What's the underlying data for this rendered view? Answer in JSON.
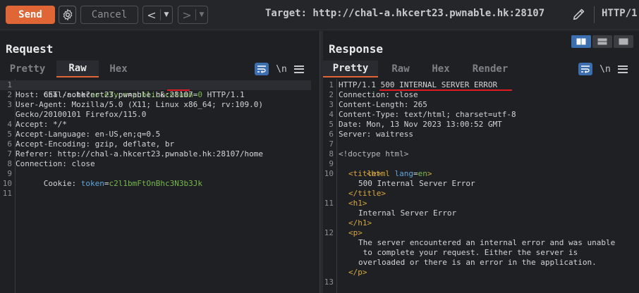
{
  "toolbar": {
    "send_label": "Send",
    "cancel_label": "Cancel",
    "target_label": "Target: http://chal-a.hkcert23.pwnable.hk:28107",
    "http_version": "HTTP/1",
    "accent": "#e16636"
  },
  "request": {
    "title": "Request",
    "tabs": [
      "Pretty",
      "Raw",
      "Hex"
    ],
    "active_tab": "Raw",
    "newline_icon": "\\n",
    "lines": {
      "l1_method": "GET /note?",
      "l1_p1k": "noteType",
      "l1_eq1": "=",
      "l1_p1v": "public",
      "l1_amp": "&",
      "l1_p2k": "column",
      "l1_eq2": "=",
      "l1_p2v": "0",
      "l1_ver": " HTTP/1.1",
      "l2": "Host: chal-a.hkcert23.pwnable.hk:28107",
      "l3a": "User-Agent: Mozilla/5.0 (X11; Linux x86_64; rv:109.0)",
      "l3b": "Gecko/20100101 Firefox/115.0",
      "l4": "Accept: */*",
      "l5": "Accept-Language: en-US,en;q=0.5",
      "l6": "Accept-Encoding: gzip, deflate, br",
      "l7": "Referer: http://chal-a.hkcert23.pwnable.hk:28107/home",
      "l8": "Connection: close",
      "l9k": "Cookie: ",
      "l9n": "token",
      "l9e": "=",
      "l9v": "c2l1bmFtOnBhc3N3b3Jk"
    },
    "line_numbers": [
      "1",
      "2",
      "3",
      "",
      "4",
      "5",
      "6",
      "7",
      "8",
      "9",
      "10",
      "11"
    ]
  },
  "response": {
    "title": "Response",
    "tabs": [
      "Pretty",
      "Raw",
      "Hex",
      "Render"
    ],
    "active_tab": "Pretty",
    "newline_icon": "\\n",
    "lines": {
      "l1": "HTTP/1.1 500 INTERNAL SERVER ERROR",
      "l2": "Connection: close",
      "l3": "Content-Length: 265",
      "l4": "Content-Type: text/html; charset=utf-8",
      "l5": "Date: Mon, 13 Nov 2023 13:00:52 GMT",
      "l6": "Server: waitress",
      "l8": "<!doctype html>",
      "l9a": "<html ",
      "l9b": "lang",
      "l9c": "=",
      "l9d": "en",
      "l9e": ">",
      "l10a": "<title>",
      "l10b": "500 Internal Server Error",
      "l10c": "</title>",
      "l11a": "<h1>",
      "l11b": "Internal Server Error",
      "l11c": "</h1>",
      "l12a": "<p>",
      "l12b": "The server encountered an internal error and was unable",
      "l12c": " to complete your request. Either the server is",
      "l12d": "overloaded or there is an error in the application.",
      "l12e": "</p>"
    },
    "line_numbers": [
      "1",
      "2",
      "3",
      "4",
      "5",
      "6",
      "7",
      "8",
      "9",
      "10",
      "11",
      "12",
      "13"
    ]
  }
}
